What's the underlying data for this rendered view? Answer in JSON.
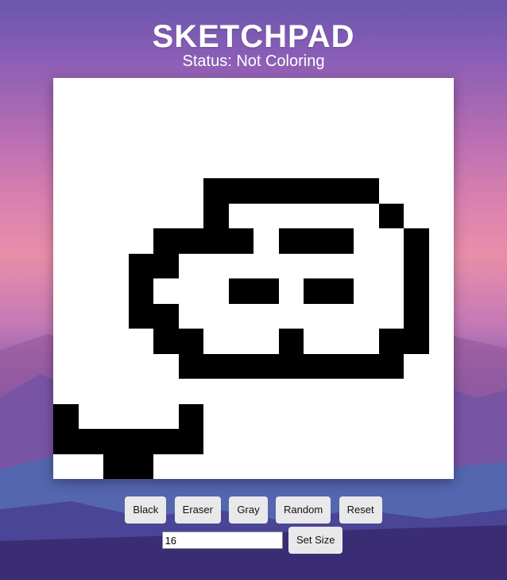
{
  "header": {
    "title": "SKETCHPAD",
    "status": "Status: Not Coloring"
  },
  "canvas": {
    "grid_size": 16,
    "pixels": [
      "0000000000000000",
      "0000000000000000",
      "0000000000000000",
      "0000000000000000",
      "0000001111111000",
      "0000001000000100",
      "0000111101110010",
      "0001100000000010",
      "0001000110110010",
      "0001100000000010",
      "0000110001000110",
      "0000011111111100",
      "0000000000000000",
      "1000010000000000",
      "1111110000000000",
      "0011000000000000"
    ],
    "colors": {
      "filled": "#000000",
      "empty": "#ffffff"
    }
  },
  "controls": {
    "buttons": [
      "Black",
      "Eraser",
      "Gray",
      "Random",
      "Reset"
    ],
    "size_input_value": "16",
    "set_size_label": "Set Size"
  }
}
